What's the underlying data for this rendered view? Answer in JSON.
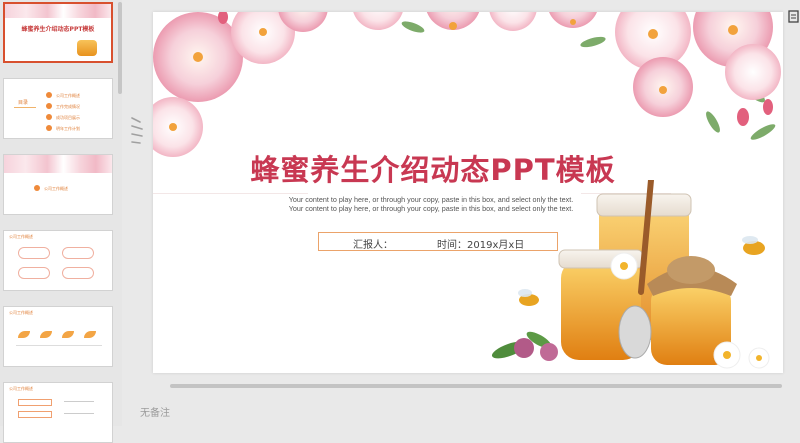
{
  "slides_panel": {
    "thumbnails": [
      {
        "title": "蜂蜜养生介绍动态PPT模板"
      },
      {
        "heading": "目录",
        "items": [
          "公司工作概述",
          "工作完成情况",
          "成功项目展示",
          "明年工作计划"
        ]
      },
      {
        "heading": "公司工作概述"
      },
      {
        "heading": "公司工作概述"
      },
      {
        "heading": "公司工作概述"
      },
      {
        "heading": "公司工作概述"
      }
    ]
  },
  "slide": {
    "title": "蜂蜜养生介绍动态PPT模板",
    "body": "Your content to play here, or through your copy, paste in this box, and select only the text. Your content to play here, or through your copy, paste in this box, and select only the text.",
    "reporter_label": "汇报人：",
    "time_label": "时间：2019x月x日"
  },
  "notes": {
    "placeholder": "无备注"
  },
  "colors": {
    "accent": "#d8502e",
    "title": "#c83852",
    "honey": "#f0a02a",
    "petal": "#f2b8c6"
  },
  "icons": [
    "splitter-grip-icon",
    "panel-toggle-icon"
  ]
}
